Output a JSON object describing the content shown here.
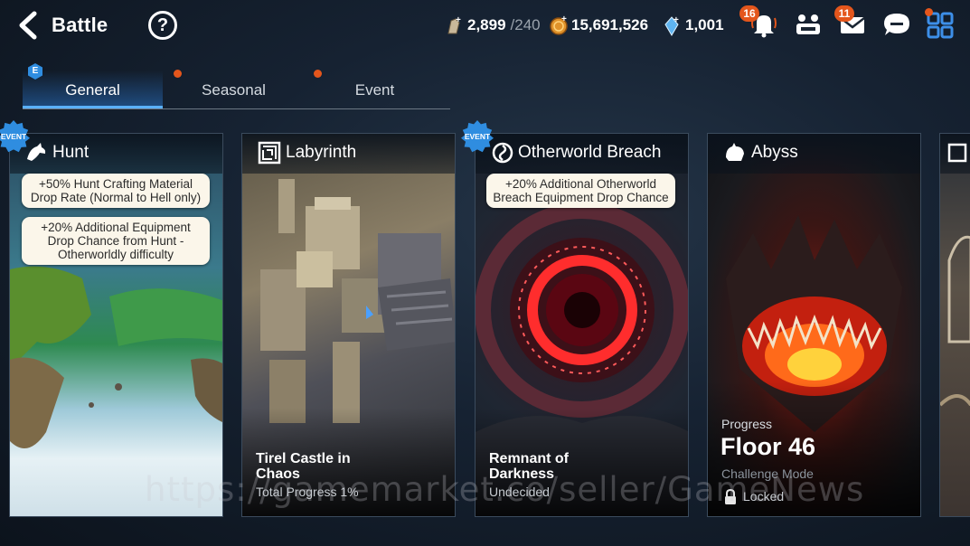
{
  "header": {
    "title": "Battle",
    "help_glyph": "?"
  },
  "currencies": [
    {
      "icon": "stamina-icon",
      "value": "2,899",
      "cap": "/240"
    },
    {
      "icon": "gold-coin-icon",
      "value": "15,691,526"
    },
    {
      "icon": "crystal-icon",
      "value": "1,001"
    }
  ],
  "notifications": {
    "bell_count": "16",
    "mail_count": "11"
  },
  "tabs": [
    {
      "label": "General",
      "badge": "E",
      "active": true
    },
    {
      "label": "Seasonal",
      "dot": true
    },
    {
      "label": "Event",
      "dot": true
    }
  ],
  "cards": [
    {
      "title": "Hunt",
      "icon": "hunt-dragon-icon",
      "event_badge": "EVENT",
      "bubbles": [
        "+50% Hunt Crafting Material Drop Rate (Normal to Hell only)",
        "+20% Additional Equipment Drop Chance from Hunt - Otherworldly difficulty"
      ]
    },
    {
      "title": "Labyrinth",
      "icon": "maze-icon",
      "foot_title": "Tirel Castle in Chaos",
      "foot_sub": "Total Progress 1%"
    },
    {
      "title": "Otherworld Breach",
      "icon": "portal-swirl-icon",
      "event_badge": "EVENT",
      "bubbles": [
        "+20% Additional Otherworld Breach Equipment Drop Chance"
      ],
      "foot_title": "Remnant of Darkness",
      "foot_sub": "Undecided"
    },
    {
      "title": "Abyss",
      "icon": "abyss-claw-icon",
      "progress_label": "Progress",
      "floor": "Floor 46",
      "mode": "Challenge Mode",
      "locked": "Locked"
    }
  ],
  "watermark": "https://gamemarket.co/seller/GameNews",
  "colors": {
    "accent_blue": "#5ab0ff",
    "badge_orange": "#e4561c",
    "bubble_bg": "#fbf6ea"
  }
}
